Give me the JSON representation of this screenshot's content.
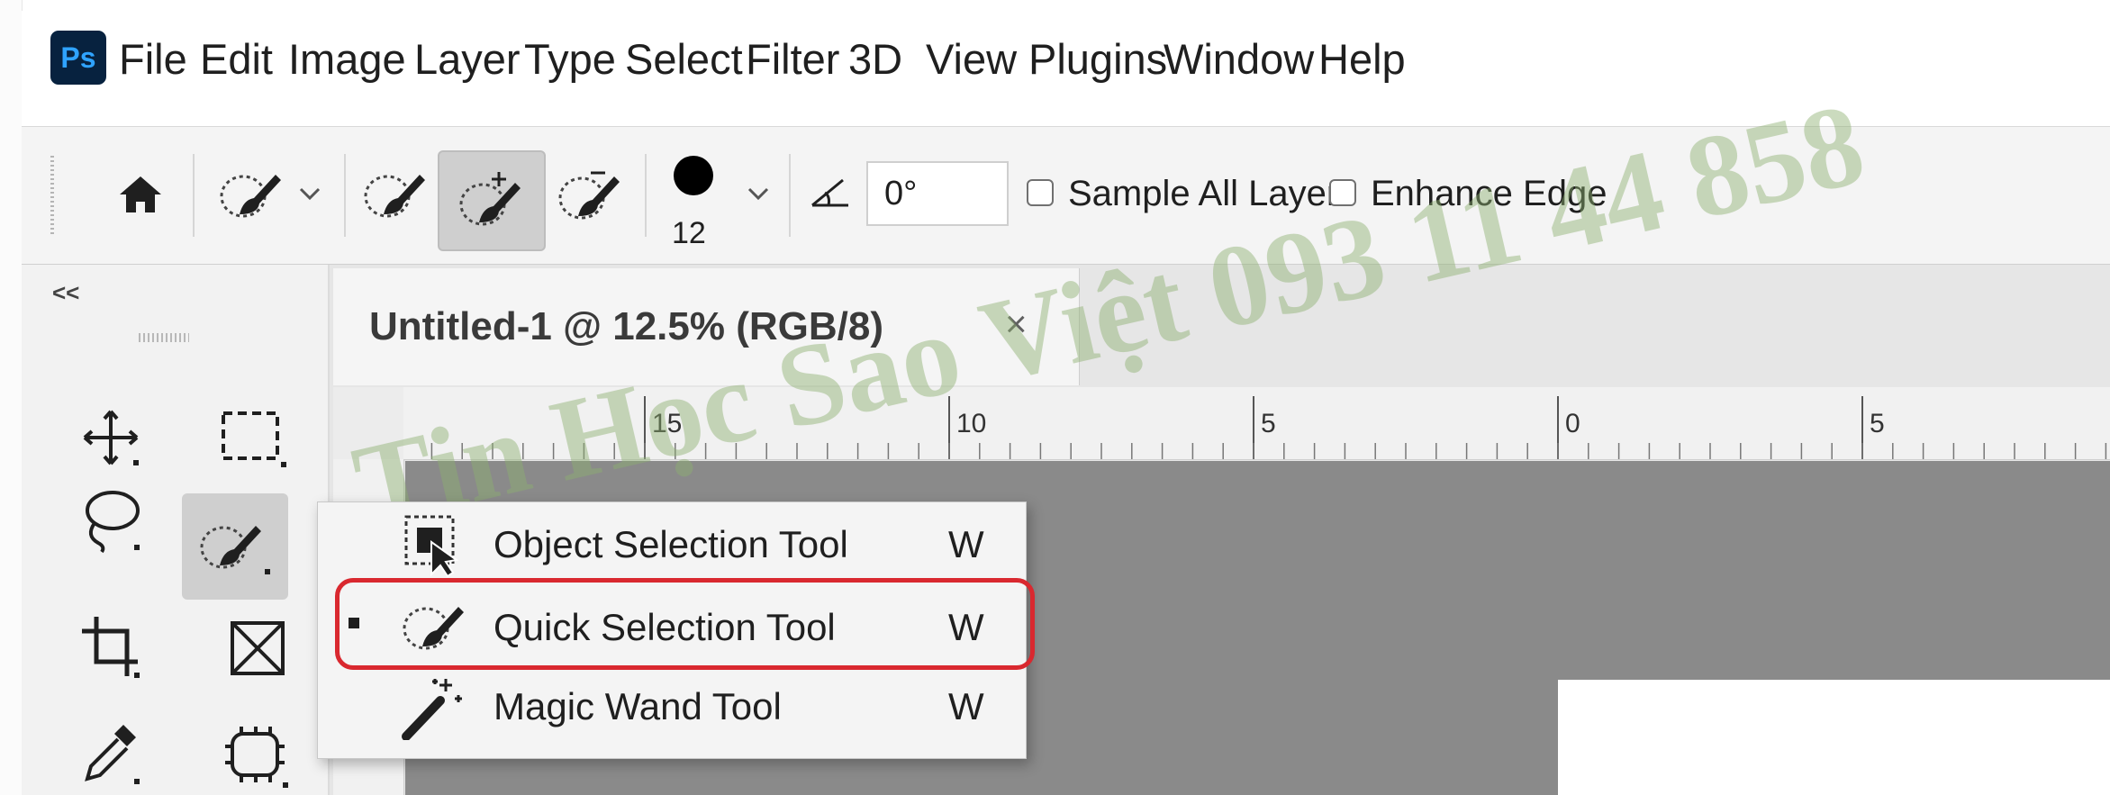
{
  "app": {
    "logo": "Ps"
  },
  "menu": [
    "File",
    "Edit",
    "Image",
    "Layer",
    "Type",
    "Select",
    "Filter",
    "3D",
    "View",
    "Plugins",
    "Window",
    "Help"
  ],
  "options_bar": {
    "angle_value": "0°",
    "brush_size": "12",
    "sample_all_layers": {
      "label": "Sample All Layers",
      "checked": false
    },
    "enhance_edge": {
      "label": "Enhance Edge",
      "checked": false
    },
    "icons": [
      "home-icon",
      "tool-preset-icon",
      "new-selection-icon",
      "add-to-selection-icon",
      "subtract-from-selection-icon",
      "brush-preview-icon",
      "angle-icon"
    ]
  },
  "toolbox": {
    "collapse": "<<"
  },
  "document": {
    "tab_title": "Untitled-1 @ 12.5% (RGB/8)",
    "close_glyph": "×",
    "ruler_labels": [
      "15",
      "10",
      "5",
      "0",
      "5"
    ]
  },
  "flyout": {
    "items": [
      {
        "label": "Object Selection Tool",
        "shortcut": "W",
        "selected": false,
        "icon": "object-selection-icon"
      },
      {
        "label": "Quick Selection Tool",
        "shortcut": "W",
        "selected": true,
        "icon": "quick-selection-icon"
      },
      {
        "label": "Magic Wand Tool",
        "shortcut": "W",
        "selected": false,
        "icon": "magic-wand-icon"
      }
    ]
  },
  "watermark": "Tin Học Sao Việt 093 11 44 858",
  "colors": {
    "accent_highlight": "#d9282f",
    "ps_blue": "#2fa3ff",
    "pasteboard": "#8a8a8a"
  }
}
